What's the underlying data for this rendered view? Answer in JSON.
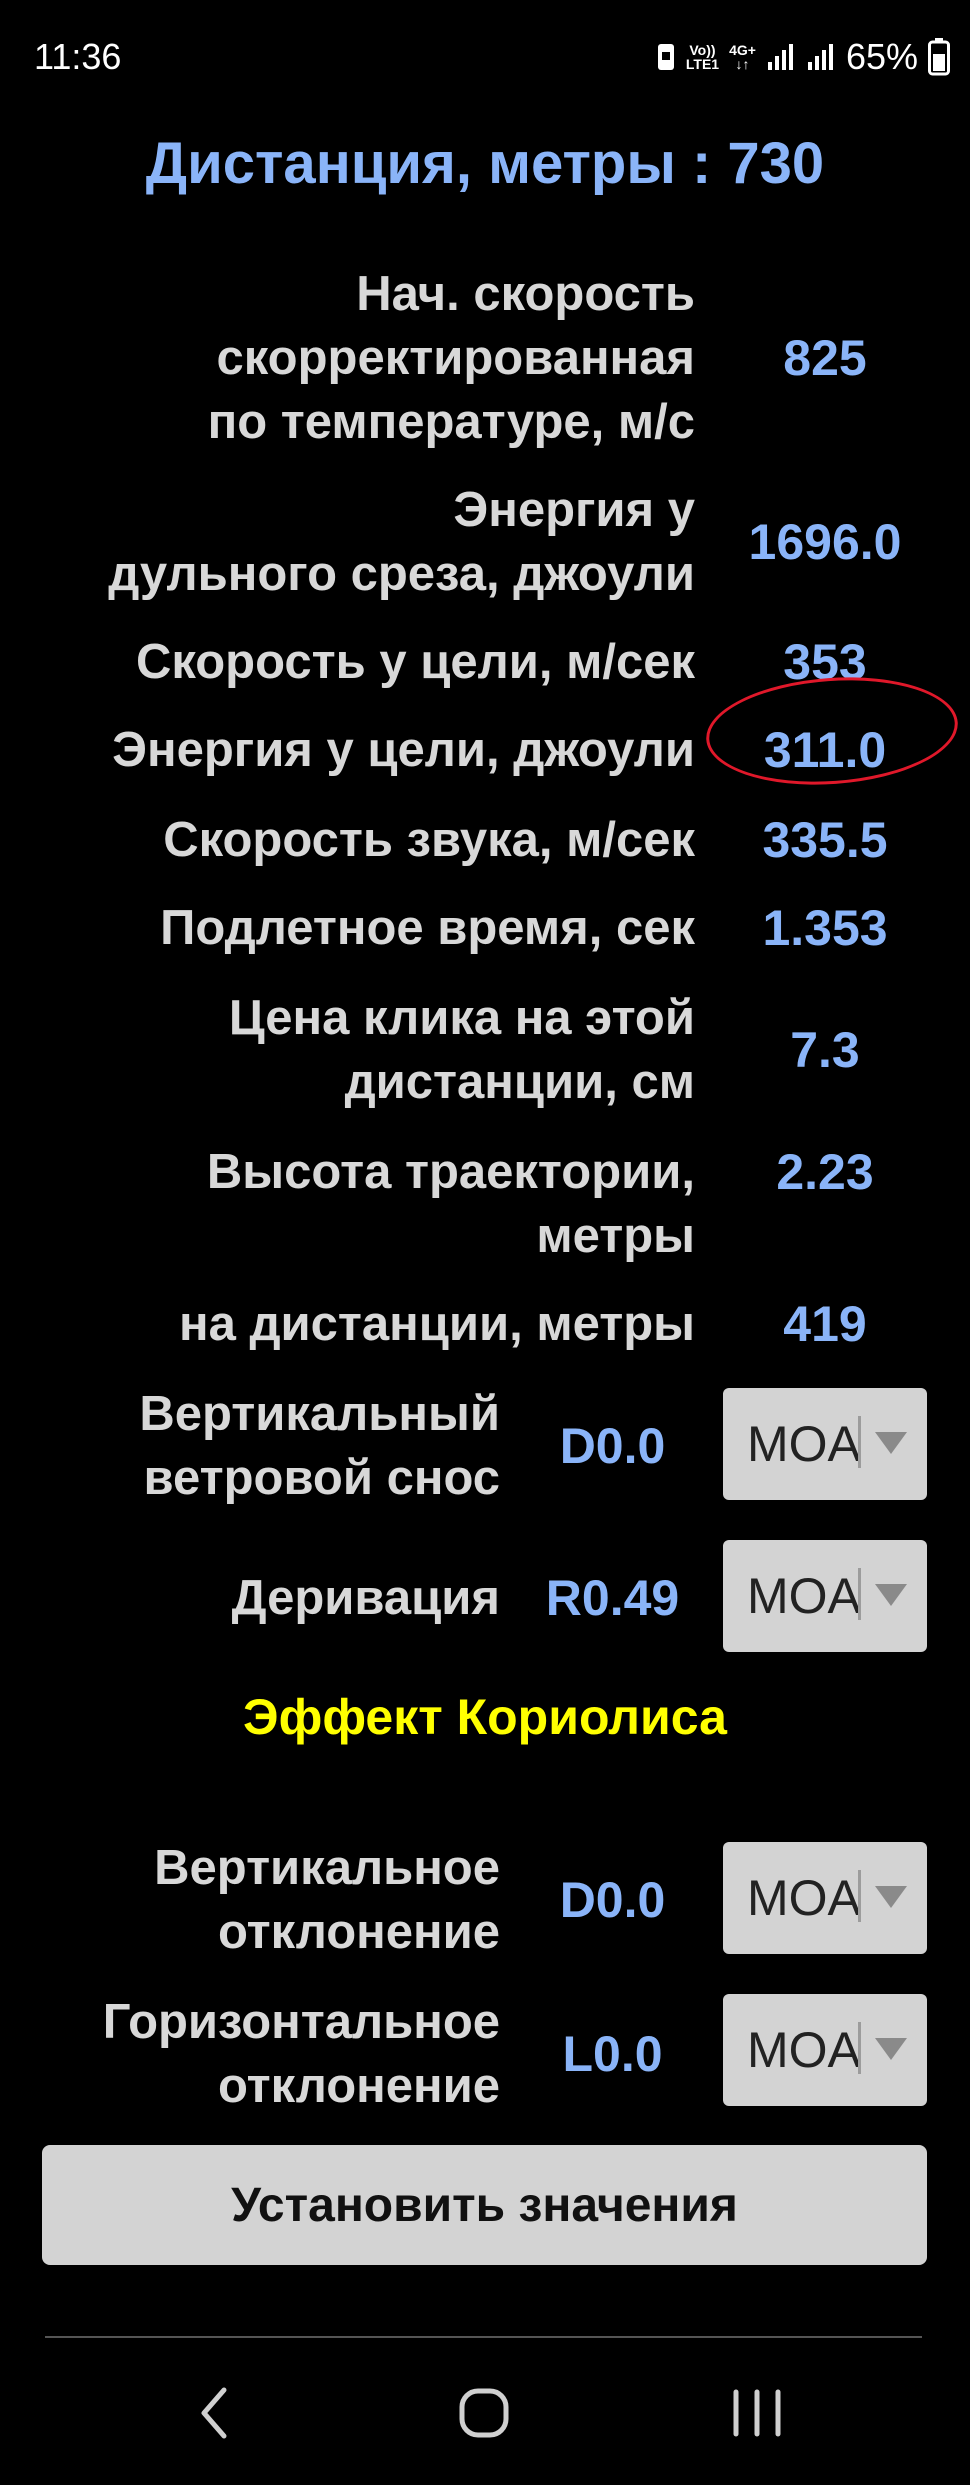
{
  "status_bar": {
    "time": "11:36",
    "volte_top": "Vo))",
    "volte_bottom": "LTE1",
    "network": "4G+",
    "battery": "65%"
  },
  "title": "Дистанция, метры : 730",
  "rows": [
    {
      "label_line1": "Нач. скорость",
      "label_line2": "скорректированная",
      "label_line3": "по температуре, м/с",
      "value": "825"
    },
    {
      "label_line1": "Энергия у",
      "label_line2": "дульного среза, джоули",
      "value": "1696.0"
    },
    {
      "label": "Скорость у цели, м/сек",
      "value": "353"
    },
    {
      "label": "Энергия у цели, джоули",
      "value": "311.0"
    },
    {
      "label": "Скорость звука, м/сек",
      "value": "335.5"
    },
    {
      "label": "Подлетное время, сек",
      "value": "1.353"
    },
    {
      "label_line1": "Цена клика на этой",
      "label_line2": "дистанции, см",
      "value": "7.3"
    },
    {
      "label_line1": "Высота траектории,",
      "label_line2": "метры",
      "value": "2.23"
    },
    {
      "label": "на дистанции, метры",
      "value": "419"
    }
  ],
  "wind": {
    "label_line1": "Вертикальный",
    "label_line2": "ветровой снос",
    "value": "D0.0",
    "unit": "MOA"
  },
  "derivation": {
    "label": "Деривация",
    "value": "R0.49",
    "unit": "MOA"
  },
  "coriolis_title": "Эффект Кориолиса",
  "coriolis_vertical": {
    "label_line1": "Вертикальное",
    "label_line2": "отклонение",
    "value": "D0.0",
    "unit": "MOA"
  },
  "coriolis_horizontal": {
    "label_line1": "Горизонтальное",
    "label_line2": "отклонение",
    "value": "L0.0",
    "unit": "MOA"
  },
  "set_button": "Установить значения",
  "colors": {
    "background": "#000000",
    "value": "#8ab4f8",
    "label": "#d8d8d8",
    "coriolis": "#ffff00",
    "annotation": "#e0182a"
  }
}
